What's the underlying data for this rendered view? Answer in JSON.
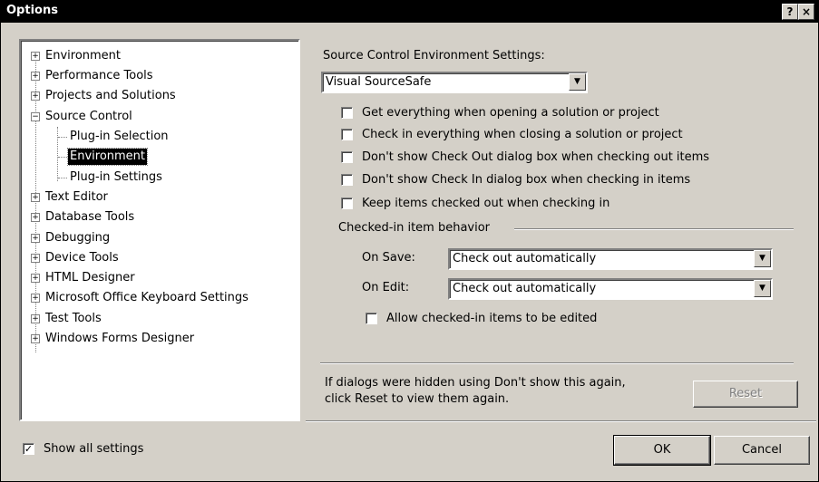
{
  "window": {
    "title": "Options",
    "help_glyph": "?",
    "close_glyph": "×"
  },
  "tree": {
    "items": [
      {
        "label": "Environment",
        "expander": "+"
      },
      {
        "label": "Performance Tools",
        "expander": "+"
      },
      {
        "label": "Projects and Solutions",
        "expander": "+"
      },
      {
        "label": "Source Control",
        "expander": "−"
      },
      {
        "label": "Plug-in Selection"
      },
      {
        "label": "Environment"
      },
      {
        "label": "Plug-in Settings"
      },
      {
        "label": "Text Editor",
        "expander": "+"
      },
      {
        "label": "Database Tools",
        "expander": "+"
      },
      {
        "label": "Debugging",
        "expander": "+"
      },
      {
        "label": "Device Tools",
        "expander": "+"
      },
      {
        "label": "HTML Designer",
        "expander": "+"
      },
      {
        "label": "Microsoft Office Keyboard Settings",
        "expander": "+"
      },
      {
        "label": "Test Tools",
        "expander": "+"
      },
      {
        "label": "Windows Forms Designer",
        "expander": "+"
      }
    ],
    "selected_index": 5
  },
  "settings": {
    "heading": "Source Control Environment Settings:",
    "scc_provider": "Visual SourceSafe",
    "checkboxes": [
      {
        "label": "Get everything when opening a solution or project",
        "checked": false
      },
      {
        "label": "Check in everything when closing a solution or project",
        "checked": false
      },
      {
        "label": "Don't show Check Out dialog box when checking out items",
        "checked": false
      },
      {
        "label": "Don't show Check In dialog box when checking in items",
        "checked": false
      },
      {
        "label": "Keep items checked out when checking in",
        "checked": false
      }
    ],
    "group_title": "Checked-in item behavior",
    "on_save_label": "On Save:",
    "on_save_value": "Check out automatically",
    "on_edit_label": "On Edit:",
    "on_edit_value": "Check out automatically",
    "allow_edit_label": "Allow checked-in items to be edited",
    "allow_edit_checked": false,
    "reset_note_line1": "If dialogs were hidden using Don't show this again,",
    "reset_note_line2": "click Reset to view them again.",
    "reset_label": "Reset"
  },
  "footer": {
    "show_all_label": "Show all settings",
    "show_all_checked": true,
    "ok_label": "OK",
    "cancel_label": "Cancel"
  },
  "colors": {
    "titlebar": "#000000",
    "face": "#d4d0c8",
    "selection": "#000000"
  }
}
